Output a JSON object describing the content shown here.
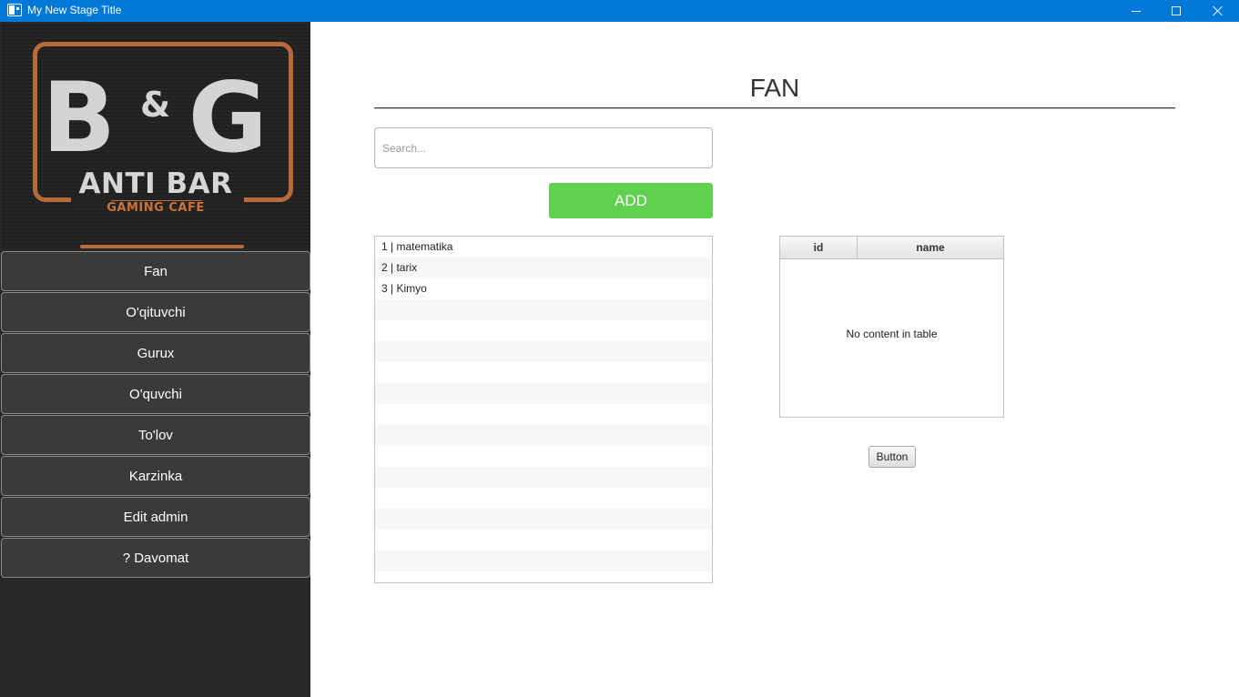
{
  "window": {
    "title": "My New Stage Title",
    "controls": {
      "minimize": "minimize-icon",
      "maximize": "maximize-icon",
      "close": "close-icon"
    }
  },
  "sidebar": {
    "logo": {
      "main": "B&G",
      "sub": "ANTI BAR",
      "tag": "GAMING CAFE"
    },
    "items": [
      {
        "label": "Fan"
      },
      {
        "label": "O'qituvchi"
      },
      {
        "label": "Gurux"
      },
      {
        "label": "O'quvchi"
      },
      {
        "label": "To'lov"
      },
      {
        "label": "Karzinka"
      },
      {
        "label": "Edit admin"
      },
      {
        "label": "? Davomat"
      }
    ]
  },
  "main": {
    "title": "FAN",
    "search": {
      "placeholder": "Search...",
      "value": ""
    },
    "add_label": "ADD",
    "list": [
      "1  |  matematika",
      "2  |  tarix",
      "3  |  Kimyo",
      "",
      "",
      "",
      "",
      "",
      "",
      "",
      "",
      "",
      "",
      "",
      "",
      "",
      ""
    ],
    "table": {
      "columns": [
        "id",
        "name"
      ],
      "empty_message": "No content in table"
    },
    "button_label": "Button"
  },
  "colors": {
    "titlebar": "#0078d7",
    "sidebar": "#282828",
    "nav_item": "#3a3a3a",
    "add_button": "#60d050",
    "logo_accent": "#b96a3a"
  }
}
